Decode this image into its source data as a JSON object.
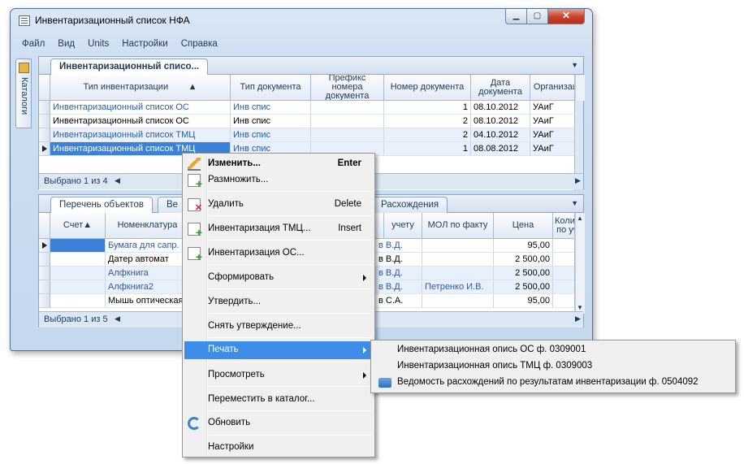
{
  "window": {
    "title": "Инвентаризационный список НФА"
  },
  "menu": [
    "Файл",
    "Вид",
    "Units",
    "Настройки",
    "Справка"
  ],
  "side_tab": "Каталоги",
  "top_panel": {
    "tab": "Инвентаризационный списо...",
    "columns": [
      "Тип инвентаризации",
      "Тип документа",
      "Префикс номера документа",
      "Номер документа",
      "Дата документа",
      "Организация"
    ],
    "rows": [
      [
        "Инвентаризационный список ОС",
        "Инв спис",
        "",
        "1",
        "08.10.2012",
        "УАиГ"
      ],
      [
        "Инвентаризационный список ОС",
        "Инв спис",
        "",
        "2",
        "08.10.2012",
        "УАиГ"
      ],
      [
        "Инвентаризационный список ТМЦ",
        "Инв спис",
        "",
        "2",
        "04.10.2012",
        "УАиГ"
      ],
      [
        "Инвентаризационный список ТМЦ",
        "Инв спис",
        "",
        "1",
        "08.08.2012",
        "УАиГ"
      ]
    ],
    "footer": "Выбрано 1 из 4"
  },
  "bottom_panel": {
    "tabs": [
      "Перечень объектов",
      "Ве",
      "Расхождения"
    ],
    "columns": [
      "Счет",
      "Номенклатура",
      "учету",
      "МОЛ по факту",
      "Цена",
      "Количество по учету"
    ],
    "col_labels": {
      "account": "Счет",
      "nomen": "Номенклатура",
      "mol_acc": "учету",
      "mol_fact": "МОЛ по факту",
      "price": "Цена",
      "qty": "Количе по уче"
    },
    "rows": [
      [
        "",
        "Бумага  для сапр.",
        "в В.Д.",
        "",
        "95,00"
      ],
      [
        "",
        "Датер автомат",
        "в В.Д.",
        "",
        "2 500,00"
      ],
      [
        "",
        "Алфкнига",
        "в В.Д.",
        "",
        "2 500,00"
      ],
      [
        "",
        "Алфкнига2",
        "в В.Д.",
        "Петренко И.В.",
        "2 500,00"
      ],
      [
        "",
        "Мышь оптическая",
        "в С.А.",
        "",
        "95,00"
      ]
    ],
    "footer": "Выбрано 1 из 5"
  },
  "context_menu": {
    "edit": "Изменить...",
    "edit_key": "Enter",
    "duplicate": "Размножить...",
    "delete": "Удалить",
    "delete_key": "Delete",
    "inv_tmc": "Инвентаризация ТМЦ...",
    "inv_tmc_key": "Insert",
    "inv_os": "Инвентаризация ОС...",
    "form": "Сформировать",
    "approve": "Утвердить...",
    "unapprove": "Снять утверждение...",
    "print": "Печать",
    "view": "Просмотреть",
    "move": "Переместить в каталог...",
    "refresh": "Обновить",
    "settings": "Настройки"
  },
  "print_submenu": [
    "Инвентаризационная опись ОС ф. 0309001",
    "Инвентаризационная опись ТМЦ ф. 0309003",
    "Ведомость расхождений по результатам инвентаризации ф. 0504092"
  ]
}
